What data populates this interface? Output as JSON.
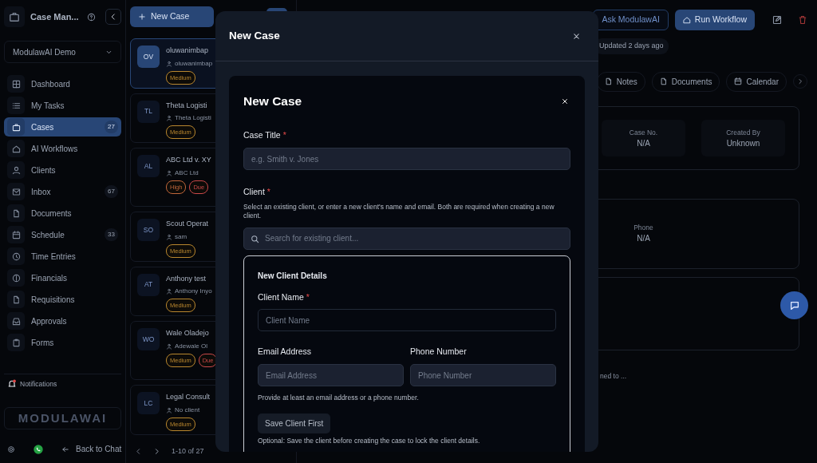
{
  "sidebar": {
    "app_title": "Case Man...",
    "workspace": "ModulawAI Demo",
    "items": [
      {
        "label": "Dashboard",
        "selected": false
      },
      {
        "label": "My Tasks",
        "selected": false
      },
      {
        "label": "Cases",
        "selected": true,
        "count": "27"
      },
      {
        "label": "AI Workflows",
        "selected": false
      },
      {
        "label": "Clients",
        "selected": false
      },
      {
        "label": "Inbox",
        "selected": false,
        "count": "67"
      },
      {
        "label": "Documents",
        "selected": false
      },
      {
        "label": "Schedule",
        "selected": false,
        "count": "33"
      },
      {
        "label": "Time Entries",
        "selected": false
      },
      {
        "label": "Financials",
        "selected": false
      },
      {
        "label": "Requisitions",
        "selected": false
      },
      {
        "label": "Approvals",
        "selected": false
      },
      {
        "label": "Forms",
        "selected": false
      }
    ],
    "notifications": "Notifications",
    "banner": "MODULAWAI",
    "back_link": "Back to Chat"
  },
  "case_list": {
    "new_button": "New Case",
    "cases": [
      {
        "initials": "OV",
        "title": "oluwanimbap",
        "client": "oluwanimbap",
        "selected": true,
        "tags": [
          {
            "label": "Medium",
            "color": "#b8862e"
          }
        ]
      },
      {
        "initials": "TL",
        "title": "Theta Logisti",
        "client": "Theta Logisti",
        "selected": false,
        "tags": [
          {
            "label": "Medium",
            "color": "#b8862e"
          }
        ]
      },
      {
        "initials": "AL",
        "title": "ABC Ltd v. XY",
        "client": "ABC Ltd",
        "selected": false,
        "tags": [
          {
            "label": "High",
            "color": "#c0663a"
          },
          {
            "label": "Due",
            "color": "#c84848"
          }
        ]
      },
      {
        "initials": "SO",
        "title": "Scout Operat",
        "client": "sam",
        "selected": false,
        "tags": [
          {
            "label": "Medium",
            "color": "#b8862e"
          }
        ]
      },
      {
        "initials": "AT",
        "title": "Anthony test",
        "client": "Anthony Inyo",
        "selected": false,
        "tags": [
          {
            "label": "Medium",
            "color": "#b8862e"
          }
        ]
      },
      {
        "initials": "WO",
        "title": "Wale Oladejo",
        "client": "Adewale Ol",
        "selected": false,
        "tags": [
          {
            "label": "Medium",
            "color": "#b8862e"
          },
          {
            "label": "Due",
            "color": "#c84848"
          }
        ]
      },
      {
        "initials": "LC",
        "title": "Legal Consult",
        "client": "No client",
        "selected": false,
        "tags": [
          {
            "label": "Medium",
            "color": "#b8862e"
          }
        ]
      }
    ],
    "pagination": "1-10 of 27"
  },
  "case_detail": {
    "ask_button": "Ask ModulawAI",
    "run_button": "Run Workflow",
    "updated": "Updated 2 days ago",
    "tabs": [
      {
        "label": "Notes",
        "selected": false
      },
      {
        "label": "Documents",
        "selected": false
      },
      {
        "label": "Calendar",
        "selected": false
      }
    ],
    "cards": [
      {
        "stats": [
          {
            "label": "Case No.",
            "value": "N/A"
          },
          {
            "label": "Created By",
            "value": "Unknown"
          }
        ]
      },
      {
        "stats": [
          {
            "label": "Phone",
            "value": "N/A"
          }
        ]
      }
    ],
    "footnote": "ned to ..."
  },
  "modal": {
    "title": "New Case",
    "form": {
      "title": "New Case",
      "case_title": {
        "label": "Case Title",
        "required_mark": "*",
        "placeholder": "e.g. Smith v. Jones"
      },
      "client": {
        "label": "Client",
        "required_mark": "*",
        "help": "Select an existing client, or enter a new client's name and email. Both are required when creating a new client.",
        "search_placeholder": "Search for existing client..."
      },
      "new_client": {
        "heading": "New Client Details",
        "name": {
          "label": "Client Name",
          "required_mark": "*",
          "placeholder": "Client Name"
        },
        "email": {
          "label": "Email Address",
          "placeholder": "Email Address"
        },
        "phone": {
          "label": "Phone Number",
          "placeholder": "Phone Number"
        },
        "contact_hint": "Provide at least an email address or a phone number.",
        "save_button": "Save Client First",
        "save_hint": "Optional: Save the client before creating the case to lock the client details."
      }
    }
  }
}
